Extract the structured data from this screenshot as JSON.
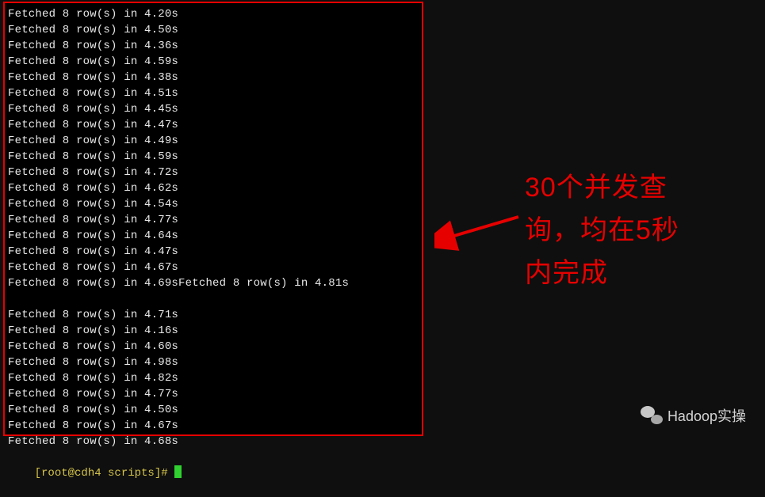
{
  "terminal": {
    "lines": [
      "Fetched 8 row(s) in 4.20s",
      "Fetched 8 row(s) in 4.50s",
      "Fetched 8 row(s) in 4.36s",
      "Fetched 8 row(s) in 4.59s",
      "Fetched 8 row(s) in 4.38s",
      "Fetched 8 row(s) in 4.51s",
      "Fetched 8 row(s) in 4.45s",
      "Fetched 8 row(s) in 4.47s",
      "Fetched 8 row(s) in 4.49s",
      "Fetched 8 row(s) in 4.59s",
      "Fetched 8 row(s) in 4.72s",
      "Fetched 8 row(s) in 4.62s",
      "Fetched 8 row(s) in 4.54s",
      "Fetched 8 row(s) in 4.77s",
      "Fetched 8 row(s) in 4.64s",
      "Fetched 8 row(s) in 4.47s",
      "Fetched 8 row(s) in 4.67s",
      "Fetched 8 row(s) in 4.69sFetched 8 row(s) in 4.81s",
      "",
      "Fetched 8 row(s) in 4.71s",
      "Fetched 8 row(s) in 4.16s",
      "Fetched 8 row(s) in 4.60s",
      "Fetched 8 row(s) in 4.98s",
      "Fetched 8 row(s) in 4.82s",
      "Fetched 8 row(s) in 4.77s",
      "Fetched 8 row(s) in 4.50s",
      "Fetched 8 row(s) in 4.67s",
      "Fetched 8 row(s) in 4.68s"
    ],
    "prompt": "[root@cdh4 scripts]# "
  },
  "annotation": {
    "text": "30个并发查\n询，均在5秒\n内完成"
  },
  "watermark": {
    "text": "Hadoop实操"
  },
  "colors": {
    "border": "#e60000",
    "annotation_text": "#e60000",
    "terminal_bg": "#000000",
    "terminal_fg": "#e8e8e8",
    "prompt_fg": "#d6c54a",
    "cursor": "#30d030"
  }
}
